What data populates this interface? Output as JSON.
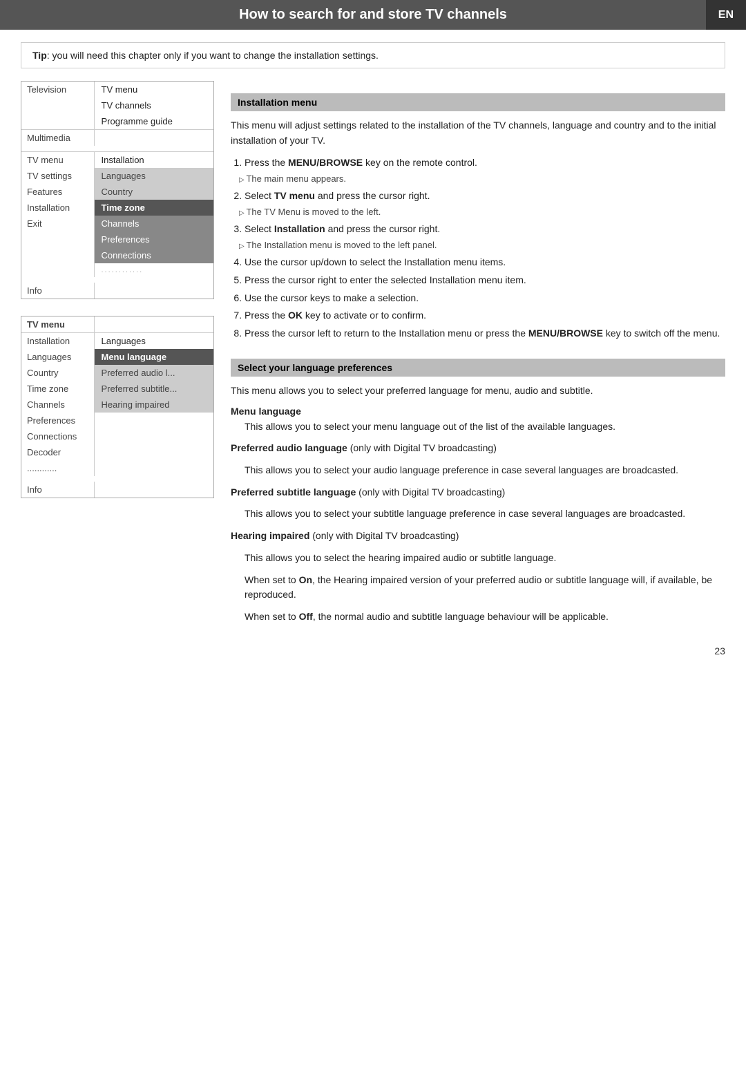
{
  "header": {
    "title": "How to search for and store TV channels",
    "lang_badge": "EN"
  },
  "tip": {
    "label": "Tip",
    "text": ": you will need this chapter only if you want to change the installation settings."
  },
  "menu1": {
    "rows": [
      {
        "left": "Television",
        "right": "TV menu",
        "style": "normal"
      },
      {
        "left": "",
        "right": "TV channels",
        "style": "normal"
      },
      {
        "left": "",
        "right": "Programme guide",
        "style": "normal"
      },
      {
        "left": "Multimedia",
        "right": "",
        "style": "divider"
      },
      {
        "left": "",
        "right": "",
        "style": "empty"
      },
      {
        "left": "TV menu",
        "right": "Installation",
        "style": "divider"
      },
      {
        "left": "TV settings",
        "right": "Languages",
        "style": "normal"
      },
      {
        "left": "Features",
        "right": "Country",
        "style": "mid"
      },
      {
        "left": "Installation",
        "right": "Time zone",
        "style": "dark"
      },
      {
        "left": "Exit",
        "right": "Channels",
        "style": "mid"
      },
      {
        "left": "",
        "right": "Preferences",
        "style": "mid"
      },
      {
        "left": "",
        "right": "Connections",
        "style": "mid"
      },
      {
        "left": "",
        "right": "............",
        "style": "dots"
      },
      {
        "left": "",
        "right": "",
        "style": "empty"
      },
      {
        "left": "Info",
        "right": "",
        "style": "normal"
      }
    ]
  },
  "section1": {
    "heading": "Installation menu",
    "intro": "This menu will adjust settings related to the installation of the TV channels, language and country and to the initial installation of your TV.",
    "steps": [
      {
        "text": "Press the ",
        "bold": "MENU/BROWSE",
        "rest": " key on the remote control.",
        "sub": "The main menu appears."
      },
      {
        "text": "Select ",
        "bold": "TV menu",
        "rest": " and press the cursor right.",
        "sub": "The TV Menu is moved to the left."
      },
      {
        "text": "Select ",
        "bold": "Installation",
        "rest": " and press the cursor right.",
        "sub": "The Installation menu is moved to the left panel."
      },
      {
        "text": "Use the cursor up/down to select the Installation menu items.",
        "bold": "",
        "rest": ""
      },
      {
        "text": "Press the cursor right to enter the selected Installation menu item.",
        "bold": "",
        "rest": ""
      },
      {
        "text": "Use the cursor keys to make a selection.",
        "bold": "",
        "rest": ""
      },
      {
        "text": "Press the ",
        "bold": "OK",
        "rest": " key to activate or to confirm."
      },
      {
        "text": "Press the cursor left to return to the Installation menu or press the ",
        "bold": "MENU/BROWSE",
        "rest": " key to switch off the menu."
      }
    ]
  },
  "menu2": {
    "rows": [
      {
        "left": "TV menu",
        "right": "",
        "style": "header"
      },
      {
        "left": "Installation",
        "right": "Languages",
        "style": "sub-header"
      },
      {
        "left": "Languages",
        "right": "Menu language",
        "style": "dark"
      },
      {
        "left": "Country",
        "right": "Preferred audio l...",
        "style": "mid"
      },
      {
        "left": "Time zone",
        "right": "Preferred subtitle...",
        "style": "mid"
      },
      {
        "left": "Channels",
        "right": "Hearing impaired",
        "style": "mid"
      },
      {
        "left": "Preferences",
        "right": "",
        "style": "normal"
      },
      {
        "left": "Connections",
        "right": "",
        "style": "normal"
      },
      {
        "left": "Decoder",
        "right": "",
        "style": "normal"
      },
      {
        "left": "............",
        "right": "",
        "style": "dots"
      },
      {
        "left": "",
        "right": "",
        "style": "empty"
      },
      {
        "left": "Info",
        "right": "",
        "style": "normal"
      }
    ]
  },
  "section2": {
    "heading": "Select your language preferences",
    "intro": "This menu allows you to select your preferred language for menu, audio and subtitle.",
    "menu_language": {
      "heading": "Menu language",
      "text": "This allows you to select your menu language out of the list of the available languages."
    },
    "preferred_audio": {
      "heading": "Preferred audio language",
      "qualifier": " (only with Digital TV broadcasting)",
      "text": "This allows you to select your audio language preference in case several languages are broadcasted."
    },
    "preferred_subtitle": {
      "heading": "Preferred subtitle language",
      "qualifier": " (only with Digital TV broadcasting)",
      "text": "This allows you to select your subtitle language preference in case several languages are broadcasted."
    },
    "hearing_impaired": {
      "heading": "Hearing impaired",
      "qualifier": " (only with Digital TV broadcasting)",
      "para1": "This allows you to select the hearing impaired audio or subtitle language.",
      "para2_start": "When set to ",
      "para2_bold": "On",
      "para2_rest": ", the Hearing impaired version of your preferred audio or subtitle language will, if available, be reproduced.",
      "para3_start": "When set to ",
      "para3_bold": "Off",
      "para3_rest": ", the normal audio and subtitle language behaviour will be applicable."
    }
  },
  "page_number": "23"
}
